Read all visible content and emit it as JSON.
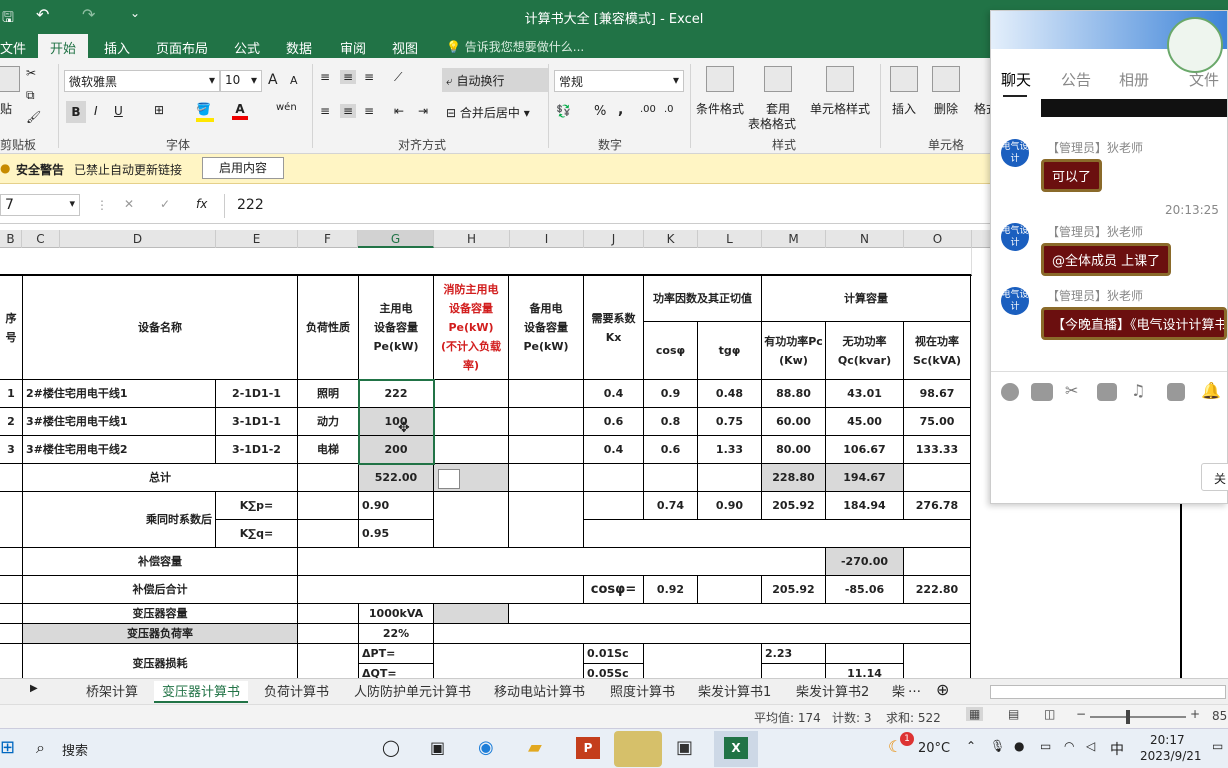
{
  "window": {
    "title": "计算书大全  [兼容模式] - Excel"
  },
  "ribbon_tabs": [
    "文件",
    "开始",
    "插入",
    "页面布局",
    "公式",
    "数据",
    "审阅",
    "视图"
  ],
  "tell_me": "告诉我您想要做什么...",
  "ribbon": {
    "paste": "贴",
    "clipboard": "剪贴板",
    "font_name": "微软雅黑",
    "font_size": "10",
    "font_group": "字体",
    "bold": "B",
    "italic": "I",
    "underline": "U",
    "grow": "A",
    "shrink": "A",
    "wen": "wén",
    "font_color": "A",
    "wrap": "自动换行",
    "merge": "合并后居中",
    "align_group": "对齐方式",
    "num_format": "常规",
    "percent": "%",
    "comma": ",",
    "number_group": "数字",
    "cond_format": "条件格式",
    "table_format_1": "套用",
    "table_format_2": "表格格式",
    "cell_style": "单元格样式",
    "style_group": "样式",
    "insert": "插入",
    "delete": "删除",
    "format": "格式",
    "cells_group": "单元格"
  },
  "security": {
    "label": "安全警告",
    "message": "已禁止自动更新链接",
    "button": "启用内容"
  },
  "formula_bar": {
    "namebox": "7",
    "fx": "fx",
    "cancel": "✕",
    "confirm": "✓",
    "value": "222"
  },
  "columns": [
    "B",
    "C",
    "D",
    "E",
    "F",
    "G",
    "H",
    "I",
    "J",
    "K",
    "L",
    "M",
    "N",
    "O"
  ],
  "headers": {
    "seq": "序\n号",
    "name": "设备名称",
    "load": "负荷性质",
    "g": "主用电\n设备容量\nPe(kW)",
    "h": "消防主用电\n设备容量\nPe(kW)\n(不计入负载\n率)",
    "i": "备用电\n设备容量\nPe(kW)",
    "j": "需要系数\nKx",
    "kl": "功率因数及其正切值",
    "k": "cosφ",
    "l": "tgφ",
    "mno": "计算容量",
    "m": "有功功率Pc\n(Kw)",
    "n": "无功功率\nQc(kvar)",
    "o": "视在功率\nSc(kVA)"
  },
  "rows": [
    {
      "seq": "1",
      "name": "2#楼住宅用电干线1",
      "code": "2-1D1-1",
      "load": "照明",
      "g": "222",
      "j": "0.4",
      "k": "0.9",
      "l": "0.48",
      "m": "88.80",
      "n": "43.01",
      "o": "98.67"
    },
    {
      "seq": "2",
      "name": "3#楼住宅用电干线1",
      "code": "3-1D1-1",
      "load": "动力",
      "g": "100",
      "j": "0.6",
      "k": "0.8",
      "l": "0.75",
      "m": "60.00",
      "n": "45.00",
      "o": "75.00"
    },
    {
      "seq": "3",
      "name": "3#楼住宅用电干线2",
      "code": "3-1D1-2",
      "load": "电梯",
      "g": "200",
      "j": "0.4",
      "k": "0.6",
      "l": "1.33",
      "m": "80.00",
      "n": "106.67",
      "o": "133.33"
    }
  ],
  "total": {
    "label": "总计",
    "g": "522.00",
    "m": "228.80",
    "n": "194.67"
  },
  "simul": {
    "label": "乘同时系数后",
    "kp": "K∑p=",
    "kq": "K∑q=",
    "gp": "0.90",
    "gq": "0.95",
    "k": "0.74",
    "l": "0.90",
    "m": "205.92",
    "n": "184.94",
    "o": "276.78"
  },
  "comp": {
    "label": "补偿容量",
    "n": "-270.00"
  },
  "after": {
    "label": "补偿后合计",
    "j": "cosφ=",
    "k": "0.92",
    "m": "205.92",
    "n": "-85.06",
    "o": "222.80"
  },
  "trans": {
    "label": "变压器容量",
    "g": "1000kVA"
  },
  "rate": {
    "label": "变压器负荷率",
    "g": "22%"
  },
  "loss": {
    "label": "变压器损耗",
    "p": "ΔPT=",
    "q": "ΔQT=",
    "jp": "0.01Sc",
    "jq": "0.05Sc",
    "m": "2.23",
    "n": "11.14"
  },
  "sheet_tabs": [
    "桥架计算",
    "变压器计算书",
    "负荷计算书",
    "人防防护单元计算书",
    "移动电站计算书",
    "照度计算书",
    "柴发计算书1",
    "柴发计算书2",
    "柴"
  ],
  "status": {
    "avg": "平均值: 174",
    "count": "计数: 3",
    "sum": "求和: 522",
    "zoom": "85"
  },
  "chat": {
    "tabs": [
      "聊天",
      "公告",
      "相册",
      "文件"
    ],
    "messages": [
      {
        "sender": "【管理员】狄老师",
        "text": "可以了"
      },
      {
        "time": "20:13:25",
        "sender": "【管理员】狄老师",
        "text": "@全体成员 上课了"
      },
      {
        "sender": "【管理员】狄老师",
        "text": "【今晚直播】《电气设计计算书"
      }
    ],
    "avatar_text": "电气设计",
    "close": "关"
  },
  "taskbar": {
    "search": "搜索",
    "weather": "20°C",
    "badge": "1",
    "ime": "中",
    "time": "20:17",
    "date": "2023/9/21"
  },
  "colors": {
    "excel_green": "#217346",
    "bubble": "#6b0f0f",
    "accent_blue": "#1b5fbf"
  }
}
